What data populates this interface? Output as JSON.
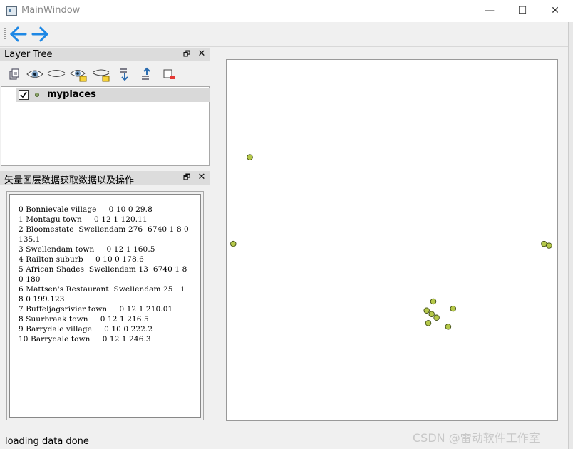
{
  "window": {
    "title": "MainWindow",
    "controls": {
      "minimize": "—",
      "maximize": "☐",
      "close": "✕"
    }
  },
  "toolbar": {
    "back_icon": "arrow-left-icon",
    "forward_icon": "arrow-right-icon",
    "accent": "#1e88e5"
  },
  "layer_tree_dock": {
    "title": "Layer Tree",
    "tool_icons": [
      "add-group-icon",
      "show-all-icon",
      "hide-all-icon",
      "show-selected-icon",
      "hide-selected-icon",
      "expand-all-icon",
      "collapse-all-icon",
      "remove-layer-icon"
    ],
    "layers": [
      {
        "name": "myplaces",
        "checked": true,
        "symbol_color": "#8ba568"
      }
    ]
  },
  "attribute_dock": {
    "title": "矢量图层数据获取数据以及操作",
    "lines": [
      "0 Bonnievale village     0 10 0 29.8",
      "1 Montagu town     0 12 1 120.11",
      "2 Bloomestate  Swellendam 276  6740 1 8 0",
      "135.1",
      "3 Swellendam town     0 12 1 160.5",
      "4 Railton suburb     0 10 0 178.6",
      "5 African Shades  Swellendam 13  6740 1 8",
      "0 180",
      "6 Mattsen's Restaurant  Swellendam 25   1",
      "8 0 199.123",
      "7 Buffeljagsrivier town     0 12 1 210.01",
      "8 Suurbraak town     0 12 1 216.5",
      "9 Barrydale village     0 10 0 222.2",
      "10 Barrydale town     0 12 1 246.3"
    ]
  },
  "map": {
    "point_fill": "#b5c84a",
    "point_stroke": "#3d4a12",
    "points": [
      [
        0.07,
        0.27
      ],
      [
        0.02,
        0.51
      ],
      [
        0.96,
        0.51
      ],
      [
        0.975,
        0.515
      ],
      [
        0.625,
        0.67
      ],
      [
        0.605,
        0.695
      ],
      [
        0.62,
        0.705
      ],
      [
        0.635,
        0.715
      ],
      [
        0.685,
        0.69
      ],
      [
        0.61,
        0.73
      ],
      [
        0.67,
        0.74
      ]
    ]
  },
  "status_bar": {
    "message": "loading data done"
  },
  "watermark": "CSDN @雷动软件工作室"
}
